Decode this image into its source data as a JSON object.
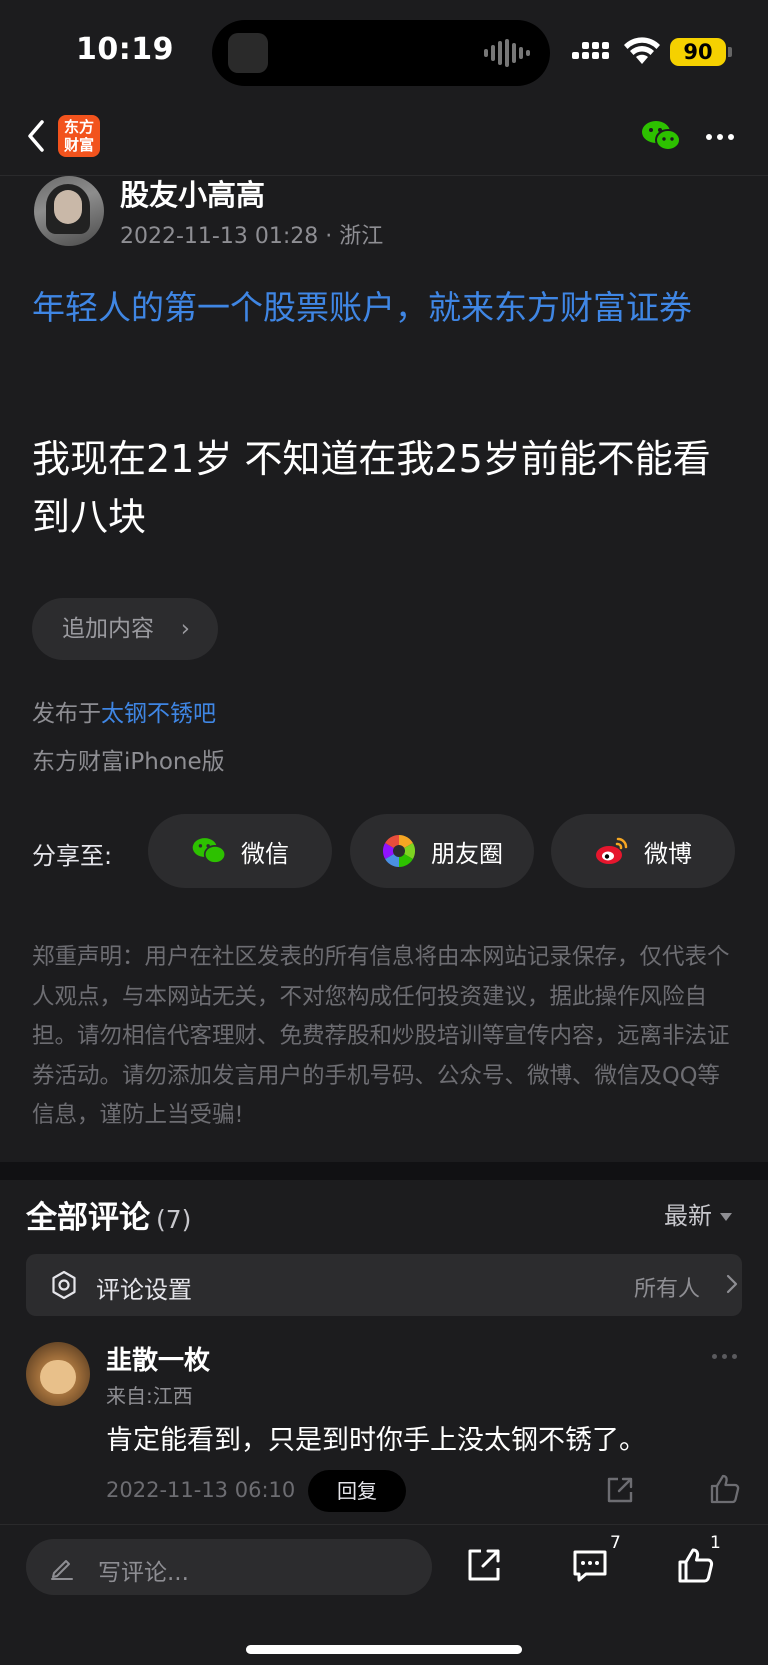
{
  "status_bar": {
    "time": "10:19",
    "battery": "90"
  },
  "nav": {
    "logo_line1": "东方",
    "logo_line2": "财富"
  },
  "post": {
    "author": "股友小高高",
    "date": "2022-11-13 01:28",
    "location": "浙江",
    "promo": "年轻人的第一个股票账户，就来东方财富证券",
    "body": "我现在21岁 不知道在我25岁前能不能看到八块",
    "append_label": "追加内容",
    "board_prefix": "发布于",
    "board_name": "太钢不锈吧",
    "client": "东方财富iPhone版"
  },
  "share": {
    "label": "分享至:",
    "wechat": "微信",
    "moments": "朋友圈",
    "weibo": "微博"
  },
  "disclaimer": "郑重声明：用户在社区发表的所有信息将由本网站记录保存，仅代表个人观点，与本网站无关，不对您构成任何投资建议，据此操作风险自担。请勿相信代客理财、免费荐股和炒股培训等宣传内容，远离非法证券活动。请勿添加发言用户的手机号码、公众号、微博、微信及QQ等信息，谨防上当受骗!",
  "comments": {
    "title": "全部评论",
    "count": "(7)",
    "sort": "最新",
    "settings_label": "评论设置",
    "settings_value": "所有人",
    "items": [
      {
        "user": "韭散一枚",
        "location": "来自:江西",
        "text": "肯定能看到，只是到时你手上没太钢不锈了。",
        "time": "2022-11-13 06:10",
        "reply_label": "回复"
      }
    ]
  },
  "bottom_bar": {
    "input_placeholder": "写评论...",
    "comment_count": "7",
    "like_count": "1"
  },
  "colors": {
    "accent_blue": "#3f86e4",
    "brand_orange": "#f2531d",
    "battery_yellow": "#f5d100",
    "wechat_green": "#2dc100"
  }
}
